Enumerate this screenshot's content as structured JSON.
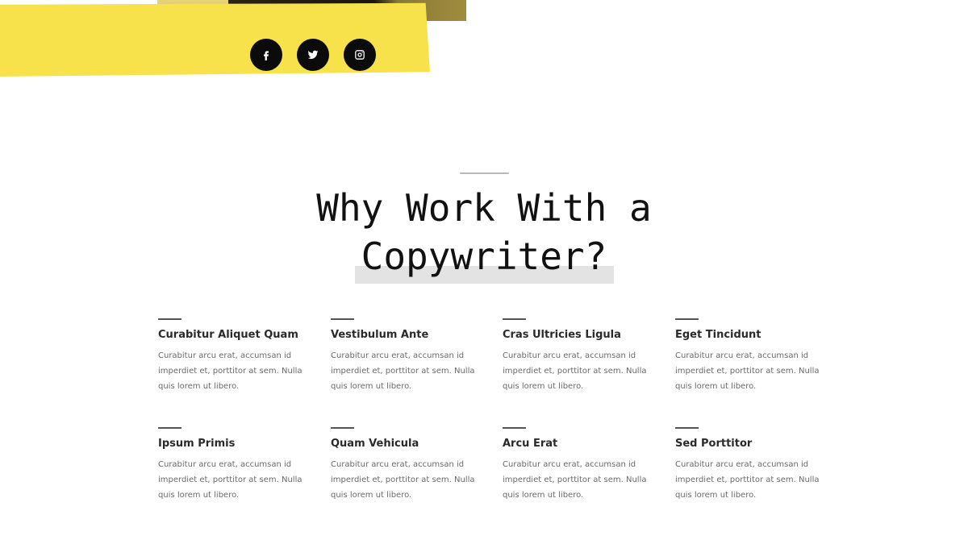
{
  "hero": {
    "social": [
      {
        "icon": "facebook-icon",
        "glyph": "f"
      },
      {
        "icon": "twitter-icon",
        "glyph": "bird"
      },
      {
        "icon": "instagram-icon",
        "glyph": "camera"
      }
    ]
  },
  "section": {
    "title": "Why Work With a Copywriter?"
  },
  "features": [
    {
      "title": "Curabitur Aliquet Quam",
      "text": "Curabitur arcu erat, accumsan id imperdiet et, porttitor at sem. Nulla quis lorem ut libero."
    },
    {
      "title": "Vestibulum Ante",
      "text": "Curabitur arcu erat, accumsan id imperdiet et, porttitor at sem. Nulla quis lorem ut libero."
    },
    {
      "title": "Cras Ultricies Ligula",
      "text": "Curabitur arcu erat, accumsan id imperdiet et, porttitor at sem. Nulla quis lorem ut libero."
    },
    {
      "title": "Eget Tincidunt",
      "text": "Curabitur arcu erat, accumsan id imperdiet et, porttitor at sem. Nulla quis lorem ut libero."
    },
    {
      "title": "Ipsum Primis",
      "text": "Curabitur arcu erat, accumsan id imperdiet et, porttitor at sem. Nulla quis lorem ut libero."
    },
    {
      "title": "Quam Vehicula",
      "text": "Curabitur arcu erat, accumsan id imperdiet et, porttitor at sem. Nulla quis lorem ut libero."
    },
    {
      "title": "Arcu Erat",
      "text": "Curabitur arcu erat, accumsan id imperdiet et, porttitor at sem. Nulla quis lorem ut libero."
    },
    {
      "title": "Sed Porttitor",
      "text": "Curabitur arcu erat, accumsan id imperdiet et, porttitor at sem. Nulla quis lorem ut libero."
    }
  ],
  "colors": {
    "accent_yellow": "#f8e24c",
    "social_bg": "#0b0b0b",
    "highlight": "#e3e3e3"
  }
}
